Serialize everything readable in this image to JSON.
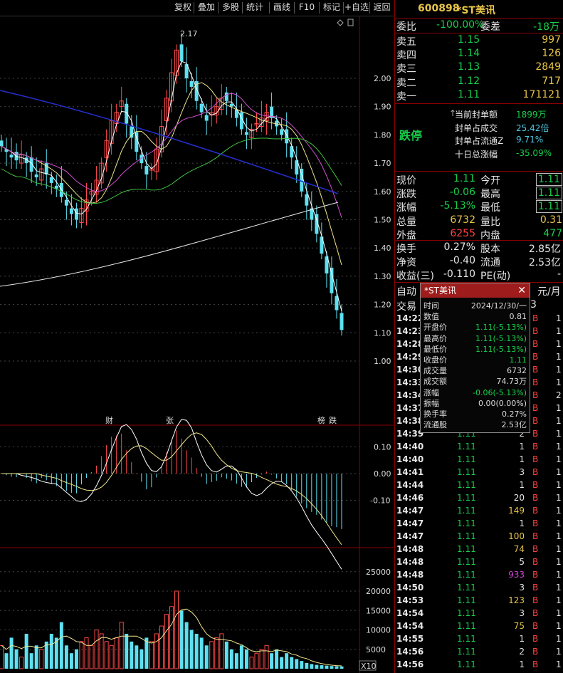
{
  "toolbar": {
    "buttons": [
      "复权",
      "叠加",
      "多股",
      "统计",
      "画线",
      "F10",
      "标记",
      "+自选",
      "返回"
    ]
  },
  "stock": {
    "code": "600898",
    "name": "*ST美讯"
  },
  "orderbook": {
    "ratio_label": "委比",
    "ratio": "-100.00%",
    "diff_label": "委差",
    "diff": "-18万",
    "asks": [
      {
        "label": "卖五",
        "price": "1.15",
        "vol": "997"
      },
      {
        "label": "卖四",
        "price": "1.14",
        "vol": "126"
      },
      {
        "label": "卖三",
        "price": "1.13",
        "vol": "2849"
      },
      {
        "label": "卖二",
        "price": "1.12",
        "vol": "717"
      },
      {
        "label": "卖一",
        "price": "1.11",
        "vol": "171121"
      }
    ]
  },
  "limit": {
    "status": "跌停",
    "lines": [
      {
        "label": "当前封单额",
        "value": "1899万"
      },
      {
        "label": "封单占成交",
        "value": "25.42倍"
      },
      {
        "label": "封单占流通Z",
        "value": "9.71%"
      },
      {
        "label": "十日总涨幅",
        "value": "-35.09%"
      }
    ]
  },
  "quote": {
    "rows": [
      {
        "l1": "现价",
        "v1": "1.11",
        "l2": "今开",
        "v2": "1.11"
      },
      {
        "l1": "涨跌",
        "v1": "-0.06",
        "l2": "最高",
        "v2": "1.11"
      },
      {
        "l1": "涨幅",
        "v1": "-5.13%",
        "l2": "最低",
        "v2": "1.11"
      },
      {
        "l1": "总量",
        "v1": "6732",
        "l2": "量比",
        "v2": "0.31"
      },
      {
        "l1": "外盘",
        "v1": "6255",
        "l2": "内盘",
        "v2": "477"
      }
    ]
  },
  "finance": {
    "rows": [
      {
        "l1": "换手",
        "v1": "0.27%",
        "l2": "股本",
        "v2": "2.85亿"
      },
      {
        "l1": "净资",
        "v1": "-0.40",
        "l2": "流通",
        "v2": "2.53亿"
      },
      {
        "l1": "收益(三)",
        "v1": "-0.110",
        "l2": "PE(动)",
        "v2": "-"
      }
    ]
  },
  "ticks_header": {
    "left": "自动",
    "left2": "交易",
    "right": "元/月",
    "right2": "3"
  },
  "ticks": [
    {
      "t": "14:22",
      "p": "",
      "v": "",
      "s": "B",
      "n": "1"
    },
    {
      "t": "14:23",
      "p": "",
      "v": "",
      "s": "B",
      "n": "1"
    },
    {
      "t": "14:28",
      "p": "",
      "v": "",
      "s": "B",
      "n": "1"
    },
    {
      "t": "14:29",
      "p": "",
      "v": "",
      "s": "B",
      "n": "1"
    },
    {
      "t": "14:30",
      "p": "",
      "v": "",
      "s": "B",
      "n": "1"
    },
    {
      "t": "14:33",
      "p": "",
      "v": "",
      "s": "B",
      "n": "1"
    },
    {
      "t": "14:34",
      "p": "",
      "v": "",
      "s": "B",
      "n": "2"
    },
    {
      "t": "14:37",
      "p": "",
      "v": "",
      "s": "B",
      "n": "1"
    },
    {
      "t": "14:38",
      "p": "",
      "v": "",
      "s": "B",
      "n": "1"
    },
    {
      "t": "14:39",
      "p": "1.11",
      "v": "2",
      "s": "B",
      "n": "1"
    },
    {
      "t": "14:40",
      "p": "1.11",
      "v": "1",
      "s": "B",
      "n": "1"
    },
    {
      "t": "14:40",
      "p": "1.11",
      "v": "1",
      "s": "B",
      "n": "1"
    },
    {
      "t": "14:41",
      "p": "1.11",
      "v": "3",
      "s": "B",
      "n": "1"
    },
    {
      "t": "14:44",
      "p": "1.11",
      "v": "1",
      "s": "B",
      "n": "1"
    },
    {
      "t": "14:46",
      "p": "1.11",
      "v": "20",
      "s": "B",
      "n": "1"
    },
    {
      "t": "14:47",
      "p": "1.11",
      "v": "149",
      "s": "B",
      "n": "1"
    },
    {
      "t": "14:47",
      "p": "1.11",
      "v": "1",
      "s": "B",
      "n": "1"
    },
    {
      "t": "14:47",
      "p": "1.11",
      "v": "100",
      "s": "B",
      "n": "1"
    },
    {
      "t": "14:48",
      "p": "1.11",
      "v": "74",
      "s": "B",
      "n": "1"
    },
    {
      "t": "14:48",
      "p": "1.11",
      "v": "5",
      "s": "B",
      "n": "1"
    },
    {
      "t": "14:48",
      "p": "1.11",
      "v": "933",
      "s": "B",
      "n": "1"
    },
    {
      "t": "14:50",
      "p": "1.11",
      "v": "3",
      "s": "B",
      "n": "1"
    },
    {
      "t": "14:53",
      "p": "1.11",
      "v": "123",
      "s": "B",
      "n": "1"
    },
    {
      "t": "14:54",
      "p": "1.11",
      "v": "3",
      "s": "B",
      "n": "1"
    },
    {
      "t": "14:54",
      "p": "1.11",
      "v": "75",
      "s": "B",
      "n": "1"
    },
    {
      "t": "14:55",
      "p": "1.11",
      "v": "1",
      "s": "B",
      "n": "1"
    },
    {
      "t": "14:56",
      "p": "1.11",
      "v": "2",
      "s": "B",
      "n": "1"
    },
    {
      "t": "14:56",
      "p": "1.11",
      "v": "1",
      "s": "B",
      "n": "1"
    }
  ],
  "tooltip": {
    "title": "*ST美讯",
    "rows": [
      {
        "k": "时间",
        "v": "2024/12/30/一"
      },
      {
        "k": "数值",
        "v": "0.81"
      },
      {
        "k": "开盘价",
        "v": "1.11(-5.13%)"
      },
      {
        "k": "最高价",
        "v": "1.11(-5.13%)"
      },
      {
        "k": "最低价",
        "v": "1.11(-5.13%)"
      },
      {
        "k": "收盘价",
        "v": "1.11"
      },
      {
        "k": "成交量",
        "v": "6732"
      },
      {
        "k": "成交额",
        "v": "74.73万"
      },
      {
        "k": "涨幅",
        "v": "-0.06(-5.13%)"
      },
      {
        "k": "振幅",
        "v": "0.00(0.00%)"
      },
      {
        "k": "换手率",
        "v": "0.27%"
      },
      {
        "k": "流通股",
        "v": "2.53亿"
      }
    ]
  },
  "chart_data": {
    "type": "candlestick",
    "price_axis": [
      "2.00",
      "1.90",
      "1.80",
      "1.70",
      "1.60",
      "1.50",
      "1.40",
      "1.30",
      "1.20",
      "1.10",
      "1.00"
    ],
    "high_label": "2.17",
    "markers": [
      "财",
      "张",
      "榜",
      "跌"
    ],
    "macd_axis": [
      "0.10",
      "0.00",
      "-0.10"
    ],
    "volume_axis": [
      "25000",
      "20000",
      "15000",
      "10000",
      "5000"
    ],
    "volume_unit": "X10",
    "closes": [
      1.76,
      1.74,
      1.72,
      1.71,
      1.73,
      1.7,
      1.67,
      1.65,
      1.68,
      1.66,
      1.63,
      1.61,
      1.58,
      1.55,
      1.52,
      1.5,
      1.54,
      1.57,
      1.6,
      1.64,
      1.7,
      1.78,
      1.85,
      1.88,
      1.92,
      1.84,
      1.79,
      1.74,
      1.7,
      1.66,
      1.68,
      1.75,
      1.83,
      1.93,
      2.02,
      2.1,
      2.06,
      2.0,
      1.97,
      1.92,
      1.88,
      1.85,
      1.88,
      1.9,
      1.93,
      1.92,
      1.9,
      1.86,
      1.82,
      1.8,
      1.82,
      1.84,
      1.86,
      1.88,
      1.86,
      1.83,
      1.8,
      1.77,
      1.72,
      1.66,
      1.6,
      1.55,
      1.5,
      1.45,
      1.38,
      1.31,
      1.24,
      1.18,
      1.11
    ],
    "volumes": [
      6000,
      4000,
      8000,
      5000,
      3000,
      9000,
      4000,
      6000,
      5000,
      7000,
      9000,
      8000,
      12000,
      6000,
      4000,
      5000,
      7000,
      8000,
      6000,
      10000,
      9000,
      7000,
      6000,
      8000,
      12000,
      9000,
      7000,
      6000,
      5000,
      8000,
      7000,
      9000,
      11000,
      14000,
      16000,
      20000,
      15000,
      12000,
      10000,
      9000,
      8000,
      6000,
      7000,
      8000,
      9000,
      7000,
      5000,
      4000,
      6000,
      5000,
      3000,
      4000,
      5000,
      6000,
      4000,
      5000,
      3000,
      4000,
      3000,
      2500,
      2000,
      1500,
      1200,
      1000,
      900,
      800,
      700,
      650,
      600
    ]
  }
}
